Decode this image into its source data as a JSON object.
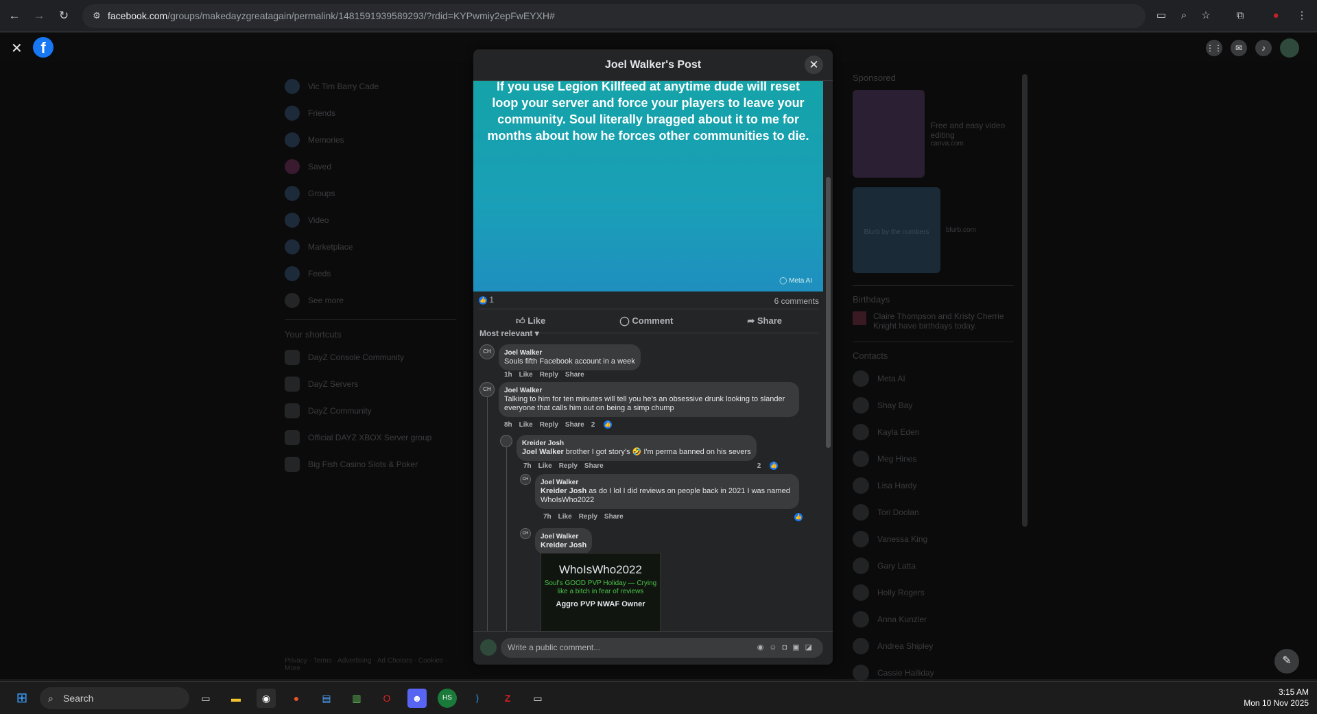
{
  "browser": {
    "url_host": "facebook.com",
    "url_path": "/groups/makedayzgreatagain/permalink/1481591939589293/?rdid=KYPwmiy2epFwEYXH#"
  },
  "sidebar": {
    "items": [
      {
        "label": "Vic Tim Barry Cade"
      },
      {
        "label": "Friends"
      },
      {
        "label": "Memories"
      },
      {
        "label": "Saved"
      },
      {
        "label": "Groups"
      },
      {
        "label": "Video"
      },
      {
        "label": "Marketplace"
      },
      {
        "label": "Feeds"
      },
      {
        "label": "See more"
      }
    ],
    "shortcuts_title": "Your shortcuts",
    "shortcuts": [
      {
        "label": "DayZ Console Community"
      },
      {
        "label": "DayZ Servers"
      },
      {
        "label": "DayZ Community"
      },
      {
        "label": "Official DAYZ XBOX Server group"
      },
      {
        "label": "Big Fish Casino Slots & Poker"
      }
    ],
    "footer": "Privacy · Terms · Advertising · Ad Choices · Cookies · More"
  },
  "right": {
    "sponsored": "Sponsored",
    "ad1_title": "Free and easy video editing",
    "ad1_domain": "canva.com",
    "ad2_title": "Blurb by the numbers",
    "ad2_domain": "blurb.com",
    "birthdays": "Birthdays",
    "birthday_text": "Claire Thompson and Kristy Cherrie Knight have birthdays today.",
    "contacts": "Contacts",
    "contact_list": [
      "Meta AI",
      "Shay Bay",
      "Kayla Eden",
      "Meg Hines",
      "Lisa Hardy",
      "Tori Doolan",
      "Vanessa King",
      "Gary Latta",
      "Holly Rogers",
      "Anna Kunzler",
      "Andrea Shipley",
      "Cassie Halliday"
    ]
  },
  "modal": {
    "title": "Joel Walker's Post",
    "post_text": "If you use Legion Killfeed at anytime dude will reset loop your server and force your players to leave your community. Soul literally bragged about it to me for months about how he forces other communities to die.",
    "meta_ai": "Meta AI",
    "reaction_count": "1",
    "comments_count": "6 comments",
    "like": "Like",
    "comment": "Comment",
    "share": "Share",
    "sort": "Most relevant",
    "comments": [
      {
        "author": "Joel Walker",
        "text": "Souls fifth Facebook account in a week",
        "time": "1h",
        "likes": ""
      },
      {
        "author": "Joel Walker",
        "text": "Talking to him for ten minutes will tell you he's an obsessive drunk looking to slander everyone that calls him out on being a simp chump",
        "time": "8h",
        "likes": "2"
      },
      {
        "author": "Kreider Josh",
        "mention": "Joel Walker",
        "text": " brother I got story's 🤣 I'm perma banned on his severs",
        "time": "7h",
        "likes": "2"
      },
      {
        "author": "Joel Walker",
        "mention": "Kreider Josh",
        "text": " as do I lol I did reviews on people back in 2021 I was named WhoIsWho2022",
        "time": "7h",
        "likes": ""
      },
      {
        "author": "Joel Walker",
        "mention": "Kreider Josh",
        "text": "",
        "time": "",
        "likes": ""
      }
    ],
    "reply": "Reply",
    "attachment": {
      "title": "WhoIsWho2022",
      "middle": "Soul's GOOD PVP Holiday — Crying like a bitch in fear of reviews",
      "footer": "Aggro PVP NWAF Owner"
    },
    "compose_placeholder": "Write a public comment..."
  },
  "taskbar": {
    "search": "Search",
    "time": "3:15 AM",
    "date": "Mon 10 Nov 2025"
  }
}
